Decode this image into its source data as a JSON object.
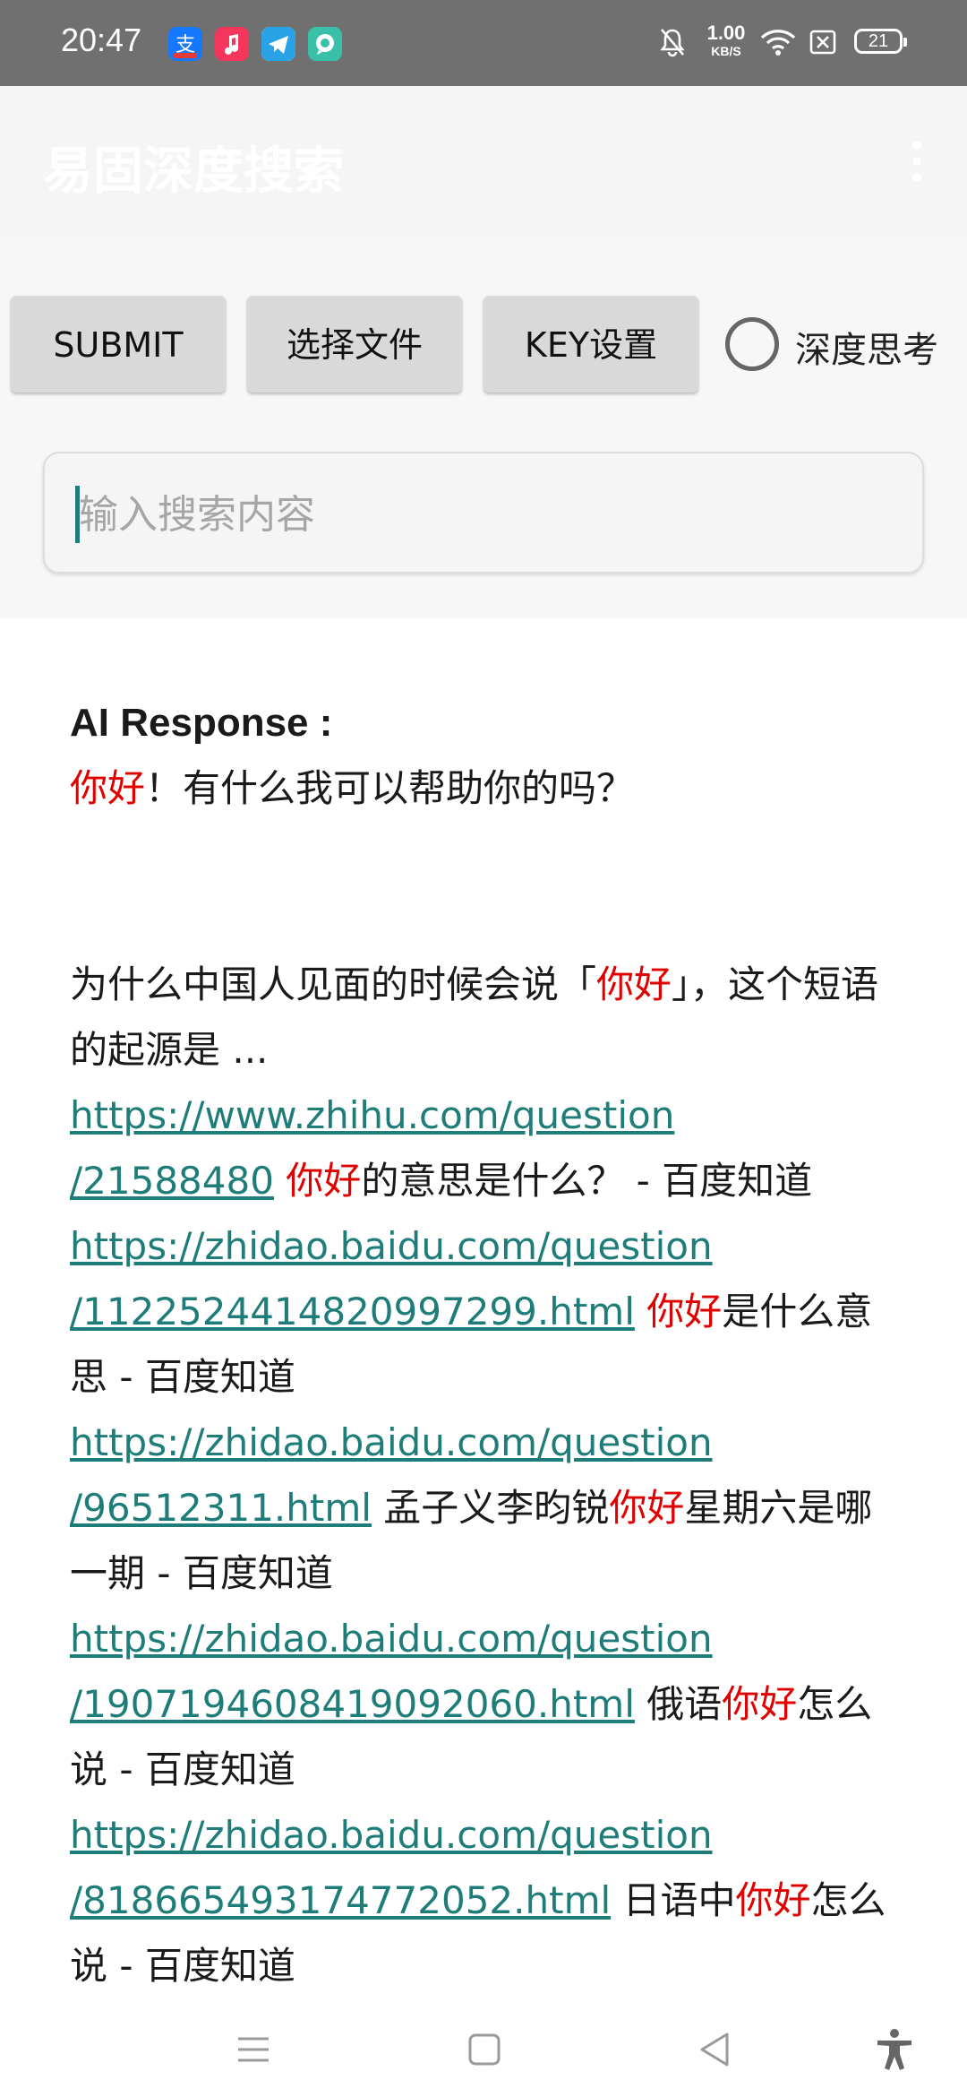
{
  "status_bar": {
    "time": "20:47",
    "net_speed_value": "1.00",
    "net_speed_unit": "KB/S",
    "battery": "21"
  },
  "toolbar": {
    "title": "易固深度搜索"
  },
  "controls": {
    "submit_label": "SUBMIT",
    "choose_file_label": "选择文件",
    "key_settings_label": "KEY设置",
    "deep_think_label": "深度思考"
  },
  "search": {
    "placeholder": "输入搜索内容",
    "value": ""
  },
  "response": {
    "heading": "AI Response :",
    "greeting_highlight": "你好",
    "greeting_rest": "！有什么我可以帮助你的吗？",
    "intro_before": "为什么中国人见面的时候会说「",
    "intro_highlight": "你好",
    "intro_after": "」，这个短语的起源是 ...",
    "results": [
      {
        "url_a": "https://www.zhihu.com/question",
        "url_b": "/21588480",
        "pre": " ",
        "hl": "你好",
        "post": "的意思是什么？ - 百度知道"
      },
      {
        "url_a": "https://zhidao.baidu.com/question",
        "url_b": "/1122524414820997299.html",
        "pre": " ",
        "hl": "你好",
        "post": "是什么意思 - 百度知道"
      },
      {
        "url_a": "https://zhidao.baidu.com/question",
        "url_b": "/96512311.html",
        "pre": " 孟子义李昀锐",
        "hl": "你好",
        "post": "星期六是哪一期 - 百度知道"
      },
      {
        "url_a": "https://zhidao.baidu.com/question",
        "url_b": "/1907194608419092060.html",
        "pre": " 俄语",
        "hl": "你好",
        "post": "怎么说 - 百度知道"
      },
      {
        "url_a": "https://zhidao.baidu.com/question",
        "url_b": "/818665493174772052.html",
        "pre": " 日语中",
        "hl": "你好",
        "post": "怎么说 - 百度知道"
      }
    ]
  },
  "colors": {
    "link": "#1e7d78",
    "highlight": "#e00000",
    "status_bar": "#707070"
  }
}
